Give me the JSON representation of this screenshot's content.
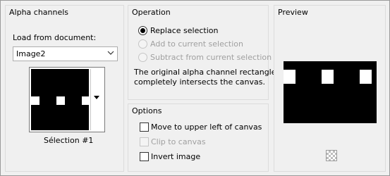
{
  "alpha_channels": {
    "title": "Alpha channels",
    "load_label": "Load from document:",
    "document_select_value": "Image2",
    "selection_caption": "Sélection #1"
  },
  "operation": {
    "title": "Operation",
    "options": [
      {
        "label": "Replace selection",
        "selected": true,
        "enabled": true
      },
      {
        "label": "Add to current selection",
        "selected": false,
        "enabled": false
      },
      {
        "label": "Subtract from current selection",
        "selected": false,
        "enabled": false
      }
    ],
    "info_line1": "The original alpha channel rectangle",
    "info_line2": "completely intersects the canvas."
  },
  "options": {
    "title": "Options",
    "items": [
      {
        "label": "Move to upper left of canvas",
        "checked": false,
        "enabled": true
      },
      {
        "label": "Clip to canvas",
        "checked": false,
        "enabled": false
      },
      {
        "label": "Invert image",
        "checked": false,
        "enabled": true
      }
    ]
  },
  "preview": {
    "title": "Preview"
  },
  "colors": {
    "dialog_bg": "#f0f0f0",
    "disabled_text": "#a0a0a0"
  }
}
